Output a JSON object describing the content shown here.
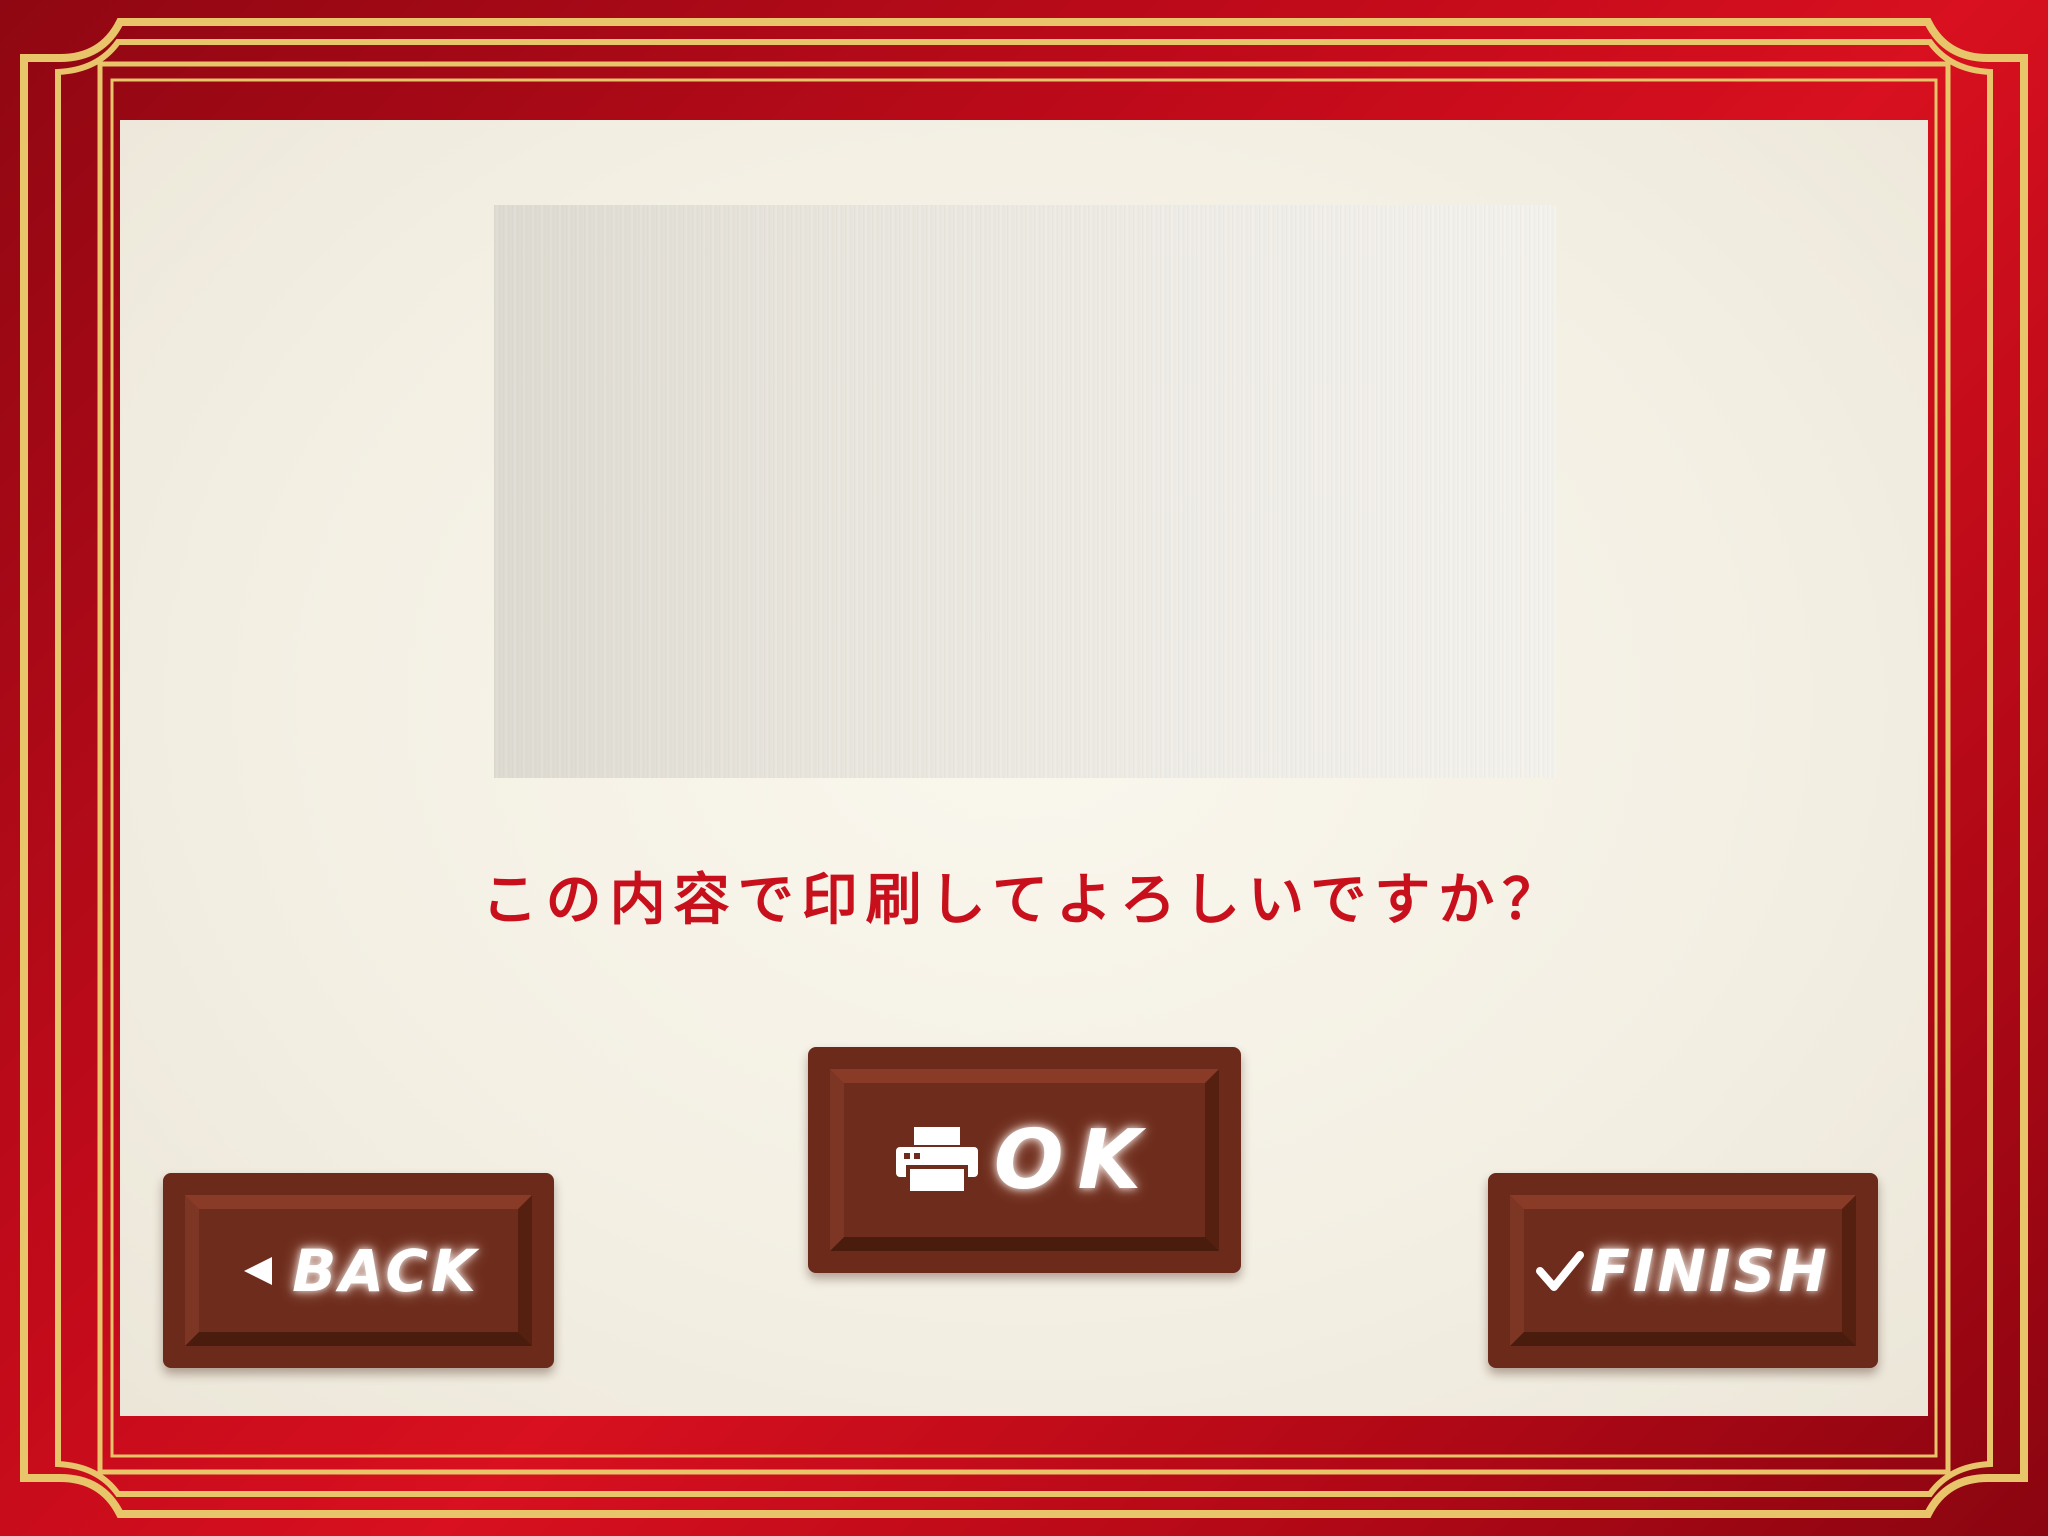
{
  "preview": {
    "label": "print preview"
  },
  "dialog": {
    "question": "この内容で印刷してよろしいですか？"
  },
  "buttons": {
    "back": {
      "label": "BACK",
      "icon": "triangle-left-icon"
    },
    "ok": {
      "label": "OK",
      "icon": "printer-icon"
    },
    "finish": {
      "label": "FINISH",
      "icon": "checkmark-icon"
    }
  },
  "colors": {
    "frame_red": "#c50b1b",
    "gold": "#e8c46a",
    "panel": "#f4f0e4",
    "question_text": "#c8101c",
    "button_chocolate": "#6c2a1b"
  }
}
